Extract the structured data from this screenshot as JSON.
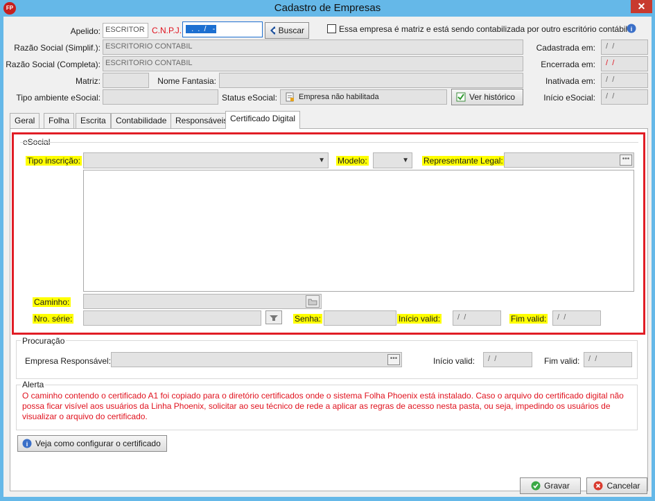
{
  "window": {
    "title": "Cadastro de Empresas",
    "app_icon_text": "FP",
    "close_glyph": "✕"
  },
  "header": {
    "apelido_label": "Apelido:",
    "apelido_value": "ESCRITOR",
    "cnpj_label": "C.N.P.J.:",
    "cnpj_value": "  .  .  /   -",
    "buscar_label": "Buscar",
    "matriz_checkbox_label": "Essa empresa é matriz e está sendo contabilizada por outro escritório contábil",
    "razao_simplif_label": "Razão Social (Simplif.):",
    "razao_simplif_value": "ESCRITORIO CONTABIL",
    "razao_completa_label": "Razão Social (Completa):",
    "razao_completa_value": "ESCRITORIO CONTABIL",
    "matriz_label": "Matriz:",
    "nome_fantasia_label": "Nome Fantasia:",
    "tipo_ambiente_label": "Tipo ambiente eSocial:",
    "status_esocial_label": "Status eSocial:",
    "status_esocial_value": "Empresa não habilitada",
    "ver_historico_label": "Ver histórico",
    "cadastrada_label": "Cadastrada em:",
    "cadastrada_value": " /  /",
    "encerrada_label": "Encerrada em:",
    "encerrada_value": " /  /",
    "inativada_label": "Inativada em:",
    "inativada_value": " /  /",
    "inicio_esocial_label": "Início eSocial:",
    "inicio_esocial_value": " /  /"
  },
  "tabs": [
    {
      "label": "Geral"
    },
    {
      "label": "Folha"
    },
    {
      "label": "Escrita"
    },
    {
      "label": "Contabilidade"
    },
    {
      "label": "Responsáveis"
    },
    {
      "label": "Certificado Digital",
      "active": true
    }
  ],
  "esocial": {
    "title": "eSocial",
    "tipo_inscricao_label": "Tipo inscrição:",
    "modelo_label": "Modelo:",
    "representante_label": "Representante Legal:",
    "caminho_label": "Caminho:",
    "nro_serie_label": "Nro. série:",
    "senha_label": "Senha:",
    "inicio_valid_label": "Início valid:",
    "inicio_valid_value": " /  /",
    "fim_valid_label": "Fim valid:",
    "fim_valid_value": " /  /"
  },
  "procuracao": {
    "title": "Procuração",
    "empresa_label": "Empresa Responsável:",
    "inicio_valid_label": "Início valid:",
    "inicio_valid_value": " /  /",
    "fim_valid_label": "Fim valid:",
    "fim_valid_value": " /  /"
  },
  "alerta": {
    "title": "Alerta",
    "text": "O caminho contendo o certificado A1 foi copiado para o diretório certificados onde o sistema Folha Phoenix está instalado. Caso o arquivo do certificado digital não possa ficar visível aos usuários da Linha Phoenix, solicitar ao seu técnico de rede a aplicar as regras de acesso nesta pasta, ou seja, impedindo os usuários de visualizar o arquivo do certificado."
  },
  "config_button_label": "Veja como configurar o certificado",
  "footer": {
    "gravar_label": "Gravar",
    "cancelar_label": "Cancelar"
  },
  "colors": {
    "title_bar": "#65b8e8",
    "alert_text": "#e0111d",
    "highlight_box": "#e11d25",
    "highlight_label": "#ffff00",
    "cnpj_selection": "#1c6fd1"
  }
}
